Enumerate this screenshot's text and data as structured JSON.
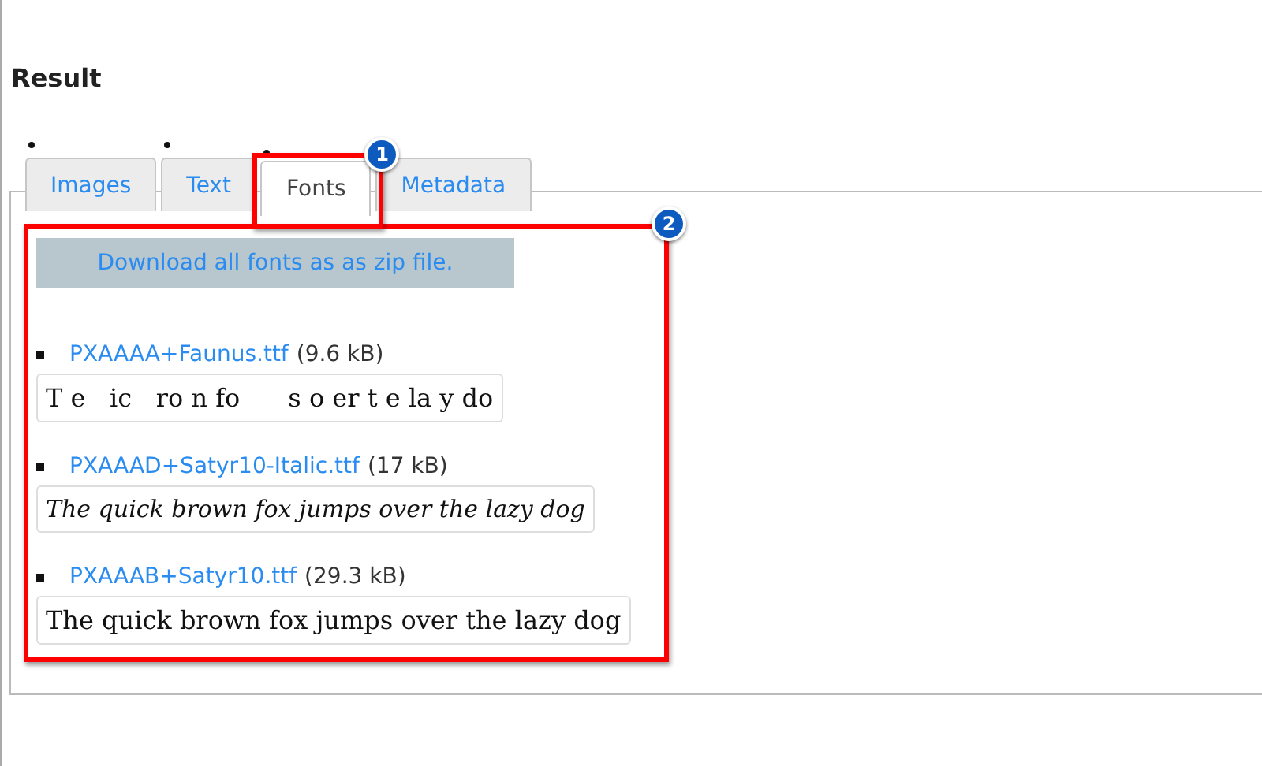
{
  "heading": "Result",
  "tabs": [
    {
      "label": "Images",
      "selected": false
    },
    {
      "label": "Text",
      "selected": false
    },
    {
      "label": "Fonts",
      "selected": true,
      "callout": "1"
    },
    {
      "label": "Metadata",
      "selected": false
    }
  ],
  "content_callout": "2",
  "download_button": "Download all fonts as as zip file.",
  "fonts": [
    {
      "file": "PXAAAA+Faunus.ttf",
      "size": "(9.6 kB)",
      "kind": "regular",
      "preview": "T e   ic   ro n fo      s o er t e la y do"
    },
    {
      "file": "PXAAAD+Satyr10-Italic.ttf",
      "size": "(17 kB)",
      "kind": "italic",
      "preview": "The quick brown fox jumps over the lazy dog"
    },
    {
      "file": "PXAAAB+Satyr10.ttf",
      "size": "(29.3 kB)",
      "kind": "regular",
      "preview": "The quick brown fox jumps over the lazy dog"
    }
  ]
}
